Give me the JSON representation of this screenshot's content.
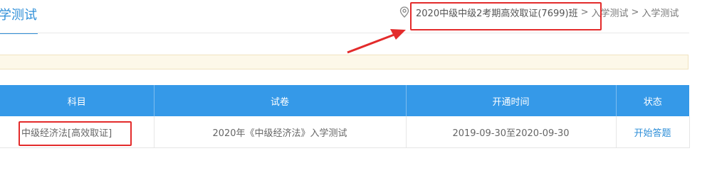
{
  "page": {
    "tab_title": "学测试",
    "breadcrumb": {
      "icon": "location-pin-icon",
      "class_name": "2020中级中级2考期高效取证(7699)班",
      "separator": ">",
      "crumb_2": "入学测试",
      "crumb_3": "入学测试"
    }
  },
  "table": {
    "headers": [
      "科目",
      "试卷",
      "开通时间",
      "状态"
    ],
    "rows": [
      {
        "subject": "中级经济法[高效取证]",
        "paper": "2020年《中级经济法》入学测试",
        "open_time": "2019-09-30至2020-09-30",
        "status": "开始答题"
      }
    ]
  },
  "colors": {
    "accent": "#2f8fd8",
    "header_bg": "#3599e8",
    "annotation_red": "#e32b2b",
    "notice_bg": "#fdf8e9"
  }
}
